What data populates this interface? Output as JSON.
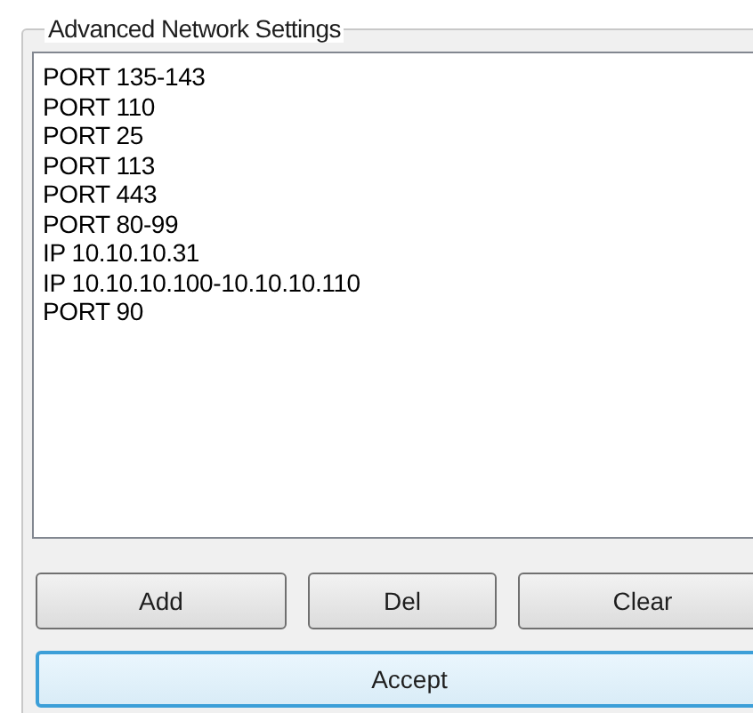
{
  "group_box": {
    "title": "Advanced Network Settings"
  },
  "list": {
    "items": [
      "PORT 135-143",
      "PORT 110",
      "PORT 25",
      "PORT 113",
      "PORT 443",
      "PORT 80-99",
      "IP 10.10.10.31",
      "IP 10.10.10.100-10.10.10.110",
      "PORT 90"
    ]
  },
  "buttons": [
    {
      "label": "Add",
      "focused": false
    },
    {
      "label": "Del",
      "focused": false
    },
    {
      "label": "Clear",
      "focused": false
    }
  ],
  "accept_button": {
    "label": "Accept",
    "focused": true
  }
}
